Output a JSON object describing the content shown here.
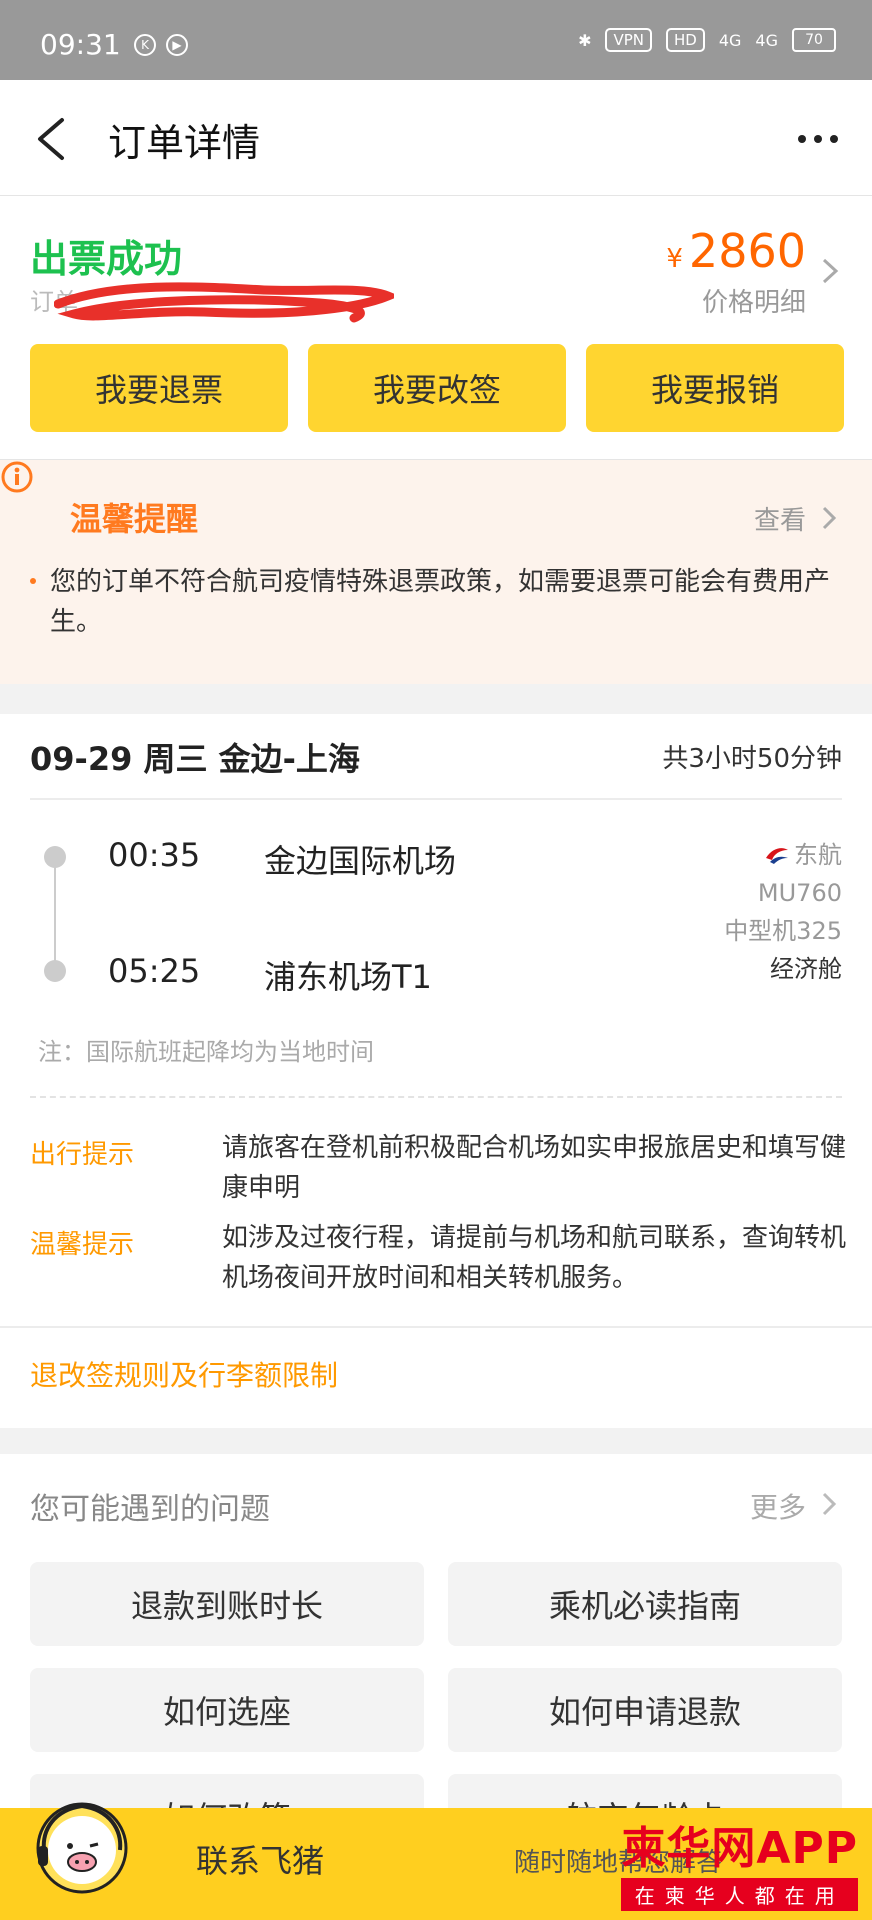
{
  "status_bar": {
    "time": "09:31",
    "icons": [
      "k-icon",
      "play-icon",
      "bluetooth-icon",
      "vpn-icon",
      "hd-icon",
      "4g-signal-icon",
      "4g-signal-icon",
      "battery-icon"
    ],
    "vpn": "VPN",
    "hd": "HD",
    "net1": "4G",
    "net2": "4G",
    "battery": "70"
  },
  "header": {
    "title": "订单详情"
  },
  "order": {
    "status": "出票成功",
    "number_prefix": "订单",
    "currency": "¥",
    "price": "2860",
    "price_detail": "价格明细",
    "status_color": "#1dc14f",
    "price_color": "#ff6600"
  },
  "actions": [
    {
      "label": "我要退票"
    },
    {
      "label": "我要改签"
    },
    {
      "label": "我要报销"
    }
  ],
  "tips": {
    "title": "温馨提醒",
    "view": "查看",
    "text": "您的订单不符合航司疫情特殊退票政策，如需要退票可能会有费用产生。"
  },
  "flight": {
    "route": "09-29 周三 金边-上海",
    "duration": "共3小时50分钟",
    "dep_time": "00:35",
    "dep_airport": "金边国际机场",
    "arr_time": "05:25",
    "arr_airport": "浦东机场T1",
    "airline": "东航",
    "flight_no": "MU760",
    "aircraft": "中型机325",
    "cabin": "经济舱",
    "note": "注：国际航班起降均为当地时间"
  },
  "hints": [
    {
      "label": "出行提示",
      "text": "请旅客在登机前积极配合机场如实申报旅居史和填写健康申明"
    },
    {
      "label": "温馨提示",
      "text": "如涉及过夜行程，请提前与机场和航司联系，查询转机机场夜间开放时间和相关转机服务。"
    }
  ],
  "rules_link": "退改签规则及行李额限制",
  "faq": {
    "title": "您可能遇到的问题",
    "more": "更多",
    "items": [
      "退款到账时长",
      "乘机必读指南",
      "如何选座",
      "如何申请退款",
      "如何改签",
      "航空年龄卡"
    ]
  },
  "bottom_bar": {
    "contact": "联系飞猪",
    "sub": "随时随地帮您解答"
  },
  "watermark": {
    "main": "柬华网APP",
    "sub": "在柬华人都在用"
  }
}
